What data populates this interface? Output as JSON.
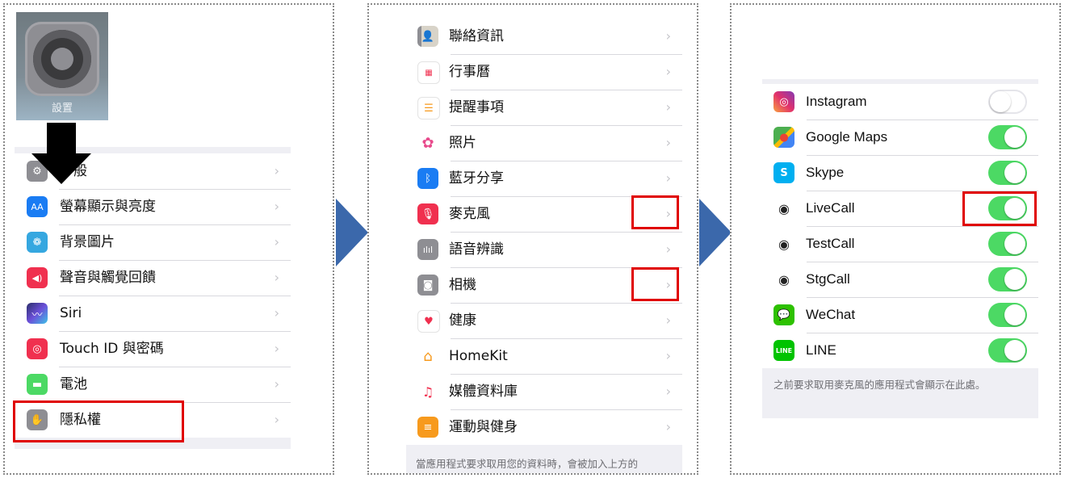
{
  "panel1": {
    "app_label": "設置",
    "rows": [
      {
        "label": "一般",
        "icon": "gear-icon",
        "color": "#8e8e93"
      },
      {
        "label": "螢幕顯示與亮度",
        "icon": "aa-icon",
        "color": "#1a7cf3"
      },
      {
        "label": "背景圖片",
        "icon": "wallpaper-icon",
        "color": "#35a7e0"
      },
      {
        "label": "聲音與觸覺回饋",
        "icon": "speaker-icon",
        "color": "#f0304f"
      },
      {
        "label": "Siri",
        "icon": "siri-icon",
        "color": "#2b2f6b"
      },
      {
        "label": "Touch ID 與密碼",
        "icon": "fingerprint-icon",
        "color": "#f0304f"
      },
      {
        "label": "電池",
        "icon": "battery-icon",
        "color": "#4cd964"
      },
      {
        "label": "隱私權",
        "icon": "hand-icon",
        "color": "#8e8e93"
      }
    ]
  },
  "panel2": {
    "rows": [
      {
        "label": "聯絡資訊",
        "icon": "contacts-icon",
        "color": "#b9b0a0"
      },
      {
        "label": "行事曆",
        "icon": "calendar-icon",
        "color": "#ffffff"
      },
      {
        "label": "提醒事項",
        "icon": "reminders-icon",
        "color": "#ffffff"
      },
      {
        "label": "照片",
        "icon": "photos-icon",
        "color": "#ffffff"
      },
      {
        "label": "藍牙分享",
        "icon": "bluetooth-icon",
        "color": "#1a7cf3"
      },
      {
        "label": "麥克風",
        "icon": "microphone-icon",
        "color": "#f0304f"
      },
      {
        "label": "語音辨識",
        "icon": "waveform-icon",
        "color": "#8e8e93"
      },
      {
        "label": "相機",
        "icon": "camera-icon",
        "color": "#8e8e93"
      },
      {
        "label": "健康",
        "icon": "heart-icon",
        "color": "#ffffff"
      },
      {
        "label": "HomeKit",
        "icon": "home-icon",
        "color": "#ffffff"
      },
      {
        "label": "媒體資料庫",
        "icon": "music-icon",
        "color": "#ffffff"
      },
      {
        "label": "運動與健身",
        "icon": "fitness-icon",
        "color": "#f79a1d"
      }
    ],
    "footer": "當應用程式要求取用您的資料時，會被加入上方的"
  },
  "panel3": {
    "rows": [
      {
        "label": "Instagram",
        "icon": "instagram-icon",
        "on": false
      },
      {
        "label": "Google Maps",
        "icon": "google-maps-icon",
        "on": true
      },
      {
        "label": "Skype",
        "icon": "skype-icon",
        "on": true
      },
      {
        "label": "LiveCall",
        "icon": "livecall-icon",
        "on": true
      },
      {
        "label": "TestCall",
        "icon": "testcall-icon",
        "on": true
      },
      {
        "label": "StgCall",
        "icon": "stgcall-icon",
        "on": true
      },
      {
        "label": "WeChat",
        "icon": "wechat-icon",
        "on": true
      },
      {
        "label": "LINE",
        "icon": "line-icon",
        "on": true
      }
    ],
    "footer": "之前要求取用麥克風的應用程式會顯示在此處。"
  },
  "colors": {
    "toggle_on": "#4cd964",
    "highlight": "#e00000",
    "flow_arrow": "#3b68ab"
  }
}
